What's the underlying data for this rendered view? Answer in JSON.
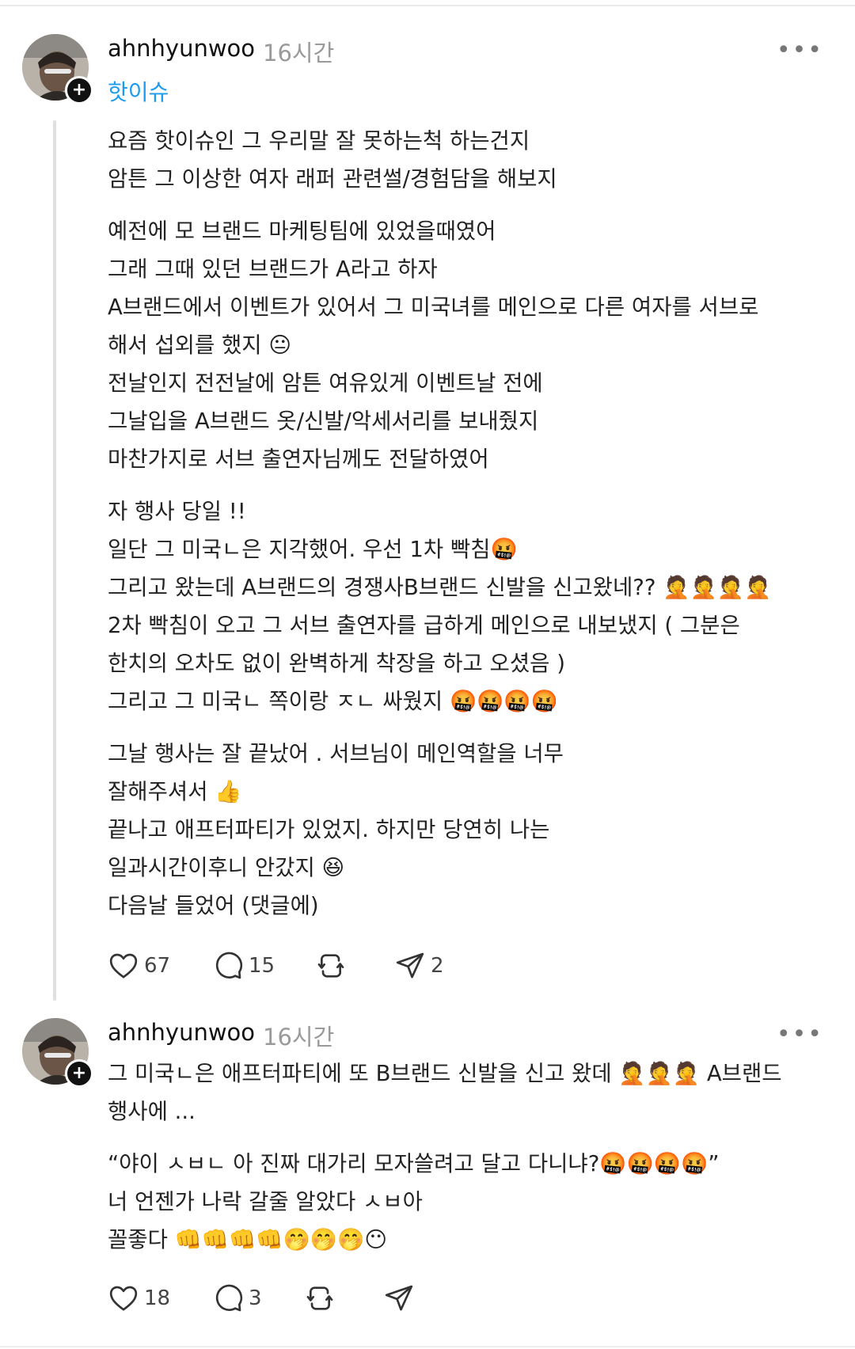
{
  "post1": {
    "username": "ahnhyunwoo",
    "time": "16시간",
    "more": "•••",
    "topic": "핫이슈",
    "lines": [
      "요즘 핫이슈인 그 우리말 잘 못하는척 하는건지",
      "암튼 그 이상한 여자 래퍼 관련썰/경험담을 해보지",
      "예전에 모 브랜드 마케팅팀에 있었을때였어",
      "그래 그때 있던 브랜드가 A라고 하자",
      "A브랜드에서 이벤트가 있어서 그 미국녀를 메인으로 다른 여자를 서브로",
      "해서 섭외를 했지 😐",
      "전날인지 전전날에 암튼 여유있게 이벤트날 전에",
      "그날입을 A브랜드 옷/신발/악세서리를 보내줬지",
      "마찬가지로 서브 출연자님께도 전달하였어",
      "자 행사 당일 !!",
      "일단 그 미국ㄴ은 지각했어. 우선 1차 빡침🤬",
      "그리고 왔는데 A브랜드의 경쟁사B브랜드 신발을 신고왔네?? 🤦🤦🤦🤦",
      "2차 빡침이 오고 그 서브 출연자를 급하게 메인으로 내보냈지 ( 그분은",
      "한치의 오차도 없이 완벽하게 착장을 하고 오셨음 )",
      "그리고 그 미국ㄴ 쪽이랑 ㅈㄴ 싸웠지 🤬🤬🤬🤬",
      "그날 행사는 잘 끝났어 . 서브님이 메인역할을 너무",
      "잘해주셔서 👍",
      "끝나고 애프터파티가 있었지. 하지만 당연히 나는",
      "일과시간이후니 안갔지 😆",
      "다음날 들었어 (댓글에)"
    ],
    "likes": "67",
    "comments": "15",
    "reposts": "",
    "shares": "2"
  },
  "post2": {
    "username": "ahnhyunwoo",
    "time": "16시간",
    "more": "•••",
    "lines": [
      "그 미국ㄴ은 애프터파티에 또 B브랜드 신발을 신고 왔데 🤦🤦🤦 A브랜드",
      "행사에 ...",
      "“야이 ㅅㅂㄴ 아 진짜 대가리 모자쓸려고 달고 다니냐?🤬🤬🤬🤬”",
      "너 언젠가 나락 갈줄 알았다 ㅅㅂ아",
      "꼴좋다 👊👊👊👊🤭🤭🤭😶"
    ],
    "likes": "18",
    "comments": "3",
    "reposts": "",
    "shares": ""
  },
  "icons": {
    "like": "heart-icon",
    "comment": "speech-bubble-icon",
    "repost": "repost-icon",
    "share": "send-icon"
  }
}
